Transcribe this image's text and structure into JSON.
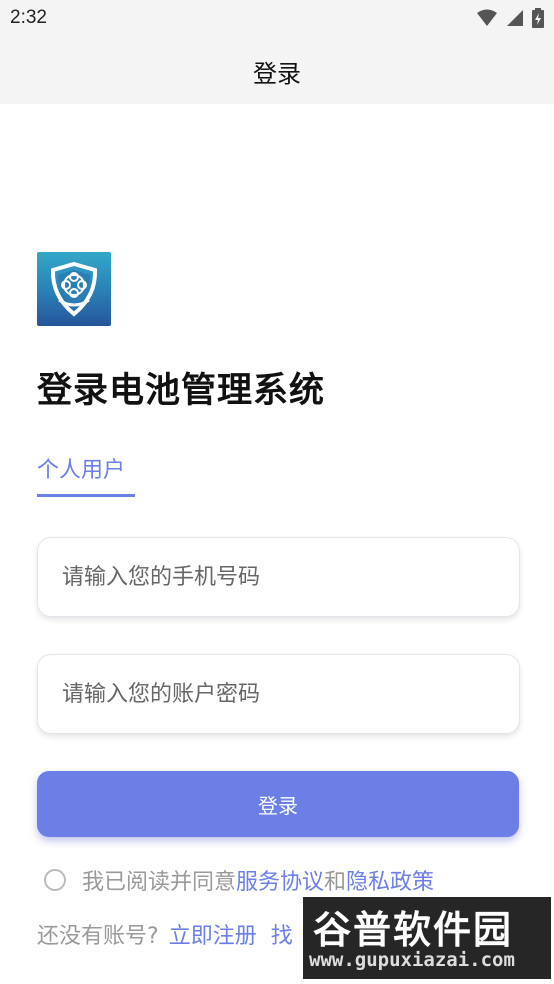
{
  "status": {
    "time": "2:32"
  },
  "appbar": {
    "title": "登录"
  },
  "logo": {
    "name": "app-logo"
  },
  "page": {
    "title": "登录电池管理系统"
  },
  "tabs": [
    {
      "label": "个人用户",
      "active": true
    }
  ],
  "form": {
    "phone_placeholder": "请输入您的手机号码",
    "password_placeholder": "请输入您的账户密码",
    "login_label": "登录"
  },
  "agreement": {
    "prefix": "我已阅读并同意",
    "service_link": "服务协议",
    "and": "和",
    "privacy_link": "隐私政策"
  },
  "register": {
    "prompt": "还没有账号?",
    "register_link": "立即注册",
    "partial_link": "找"
  },
  "watermark": {
    "title": "谷普软件园",
    "url": "www.gupuxiazai.com"
  },
  "colors": {
    "accent": "#6b7fe6",
    "muted": "#9a9a9a",
    "bar_bg": "#f4f4f4"
  }
}
